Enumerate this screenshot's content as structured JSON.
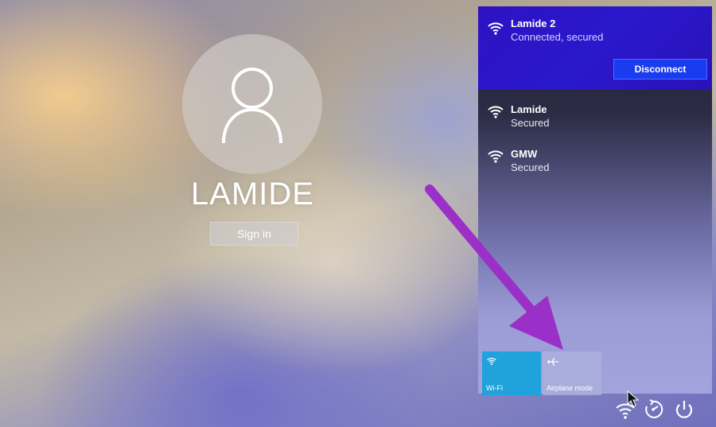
{
  "user": {
    "name": "LAMIDE",
    "sign_in_label": "Sign in"
  },
  "network_flyout": {
    "connected": {
      "name": "Lamide 2",
      "status": "Connected, secured",
      "disconnect_label": "Disconnect"
    },
    "networks": [
      {
        "name": "Lamide",
        "status": "Secured"
      },
      {
        "name": "GMW",
        "status": "Secured"
      }
    ],
    "quick_actions": [
      {
        "label": "Wi-Fi",
        "icon": "wifi-icon",
        "active": true
      },
      {
        "label": "Airplane mode",
        "icon": "airplane-icon",
        "active": false
      }
    ]
  },
  "system_icons": [
    "network-icon",
    "ease-of-access-icon",
    "power-icon"
  ],
  "colors": {
    "accent": "#2a18cc",
    "disconnect_button": "#1a3cf0",
    "wifi_tile": "#20a2dc",
    "arrow": "#9b30c8"
  }
}
